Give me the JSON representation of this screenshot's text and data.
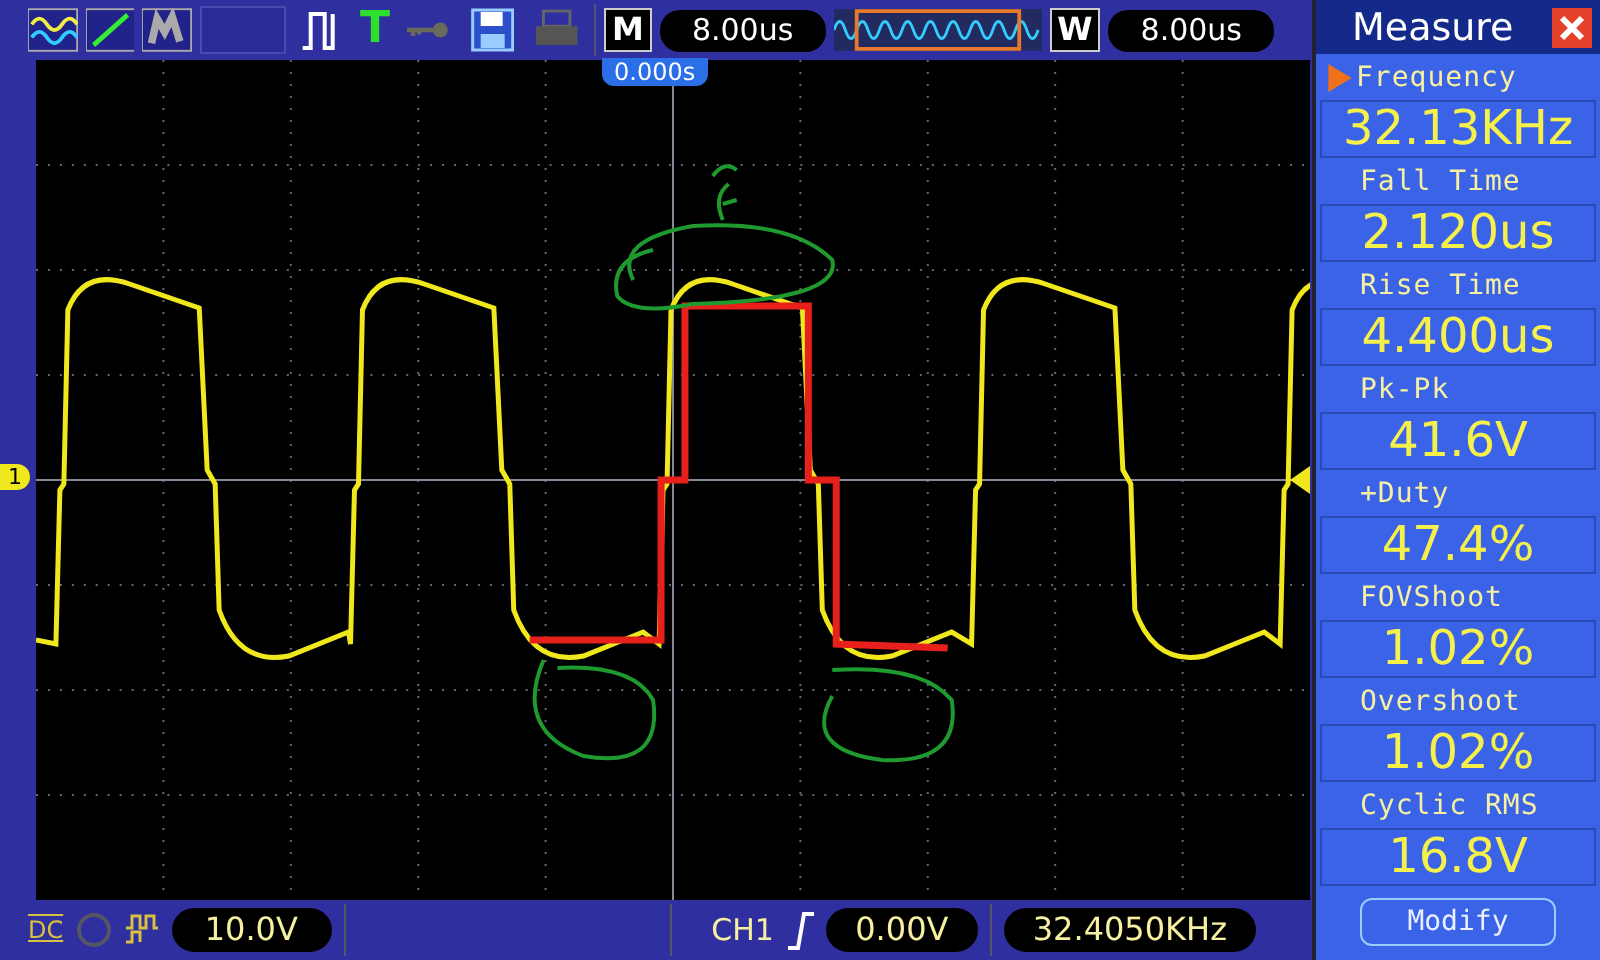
{
  "toolbar": {
    "trigger_label": "T",
    "timebase": {
      "label": "M",
      "value": "8.00us"
    },
    "window": {
      "label": "W",
      "value": "8.00us"
    }
  },
  "screen": {
    "trigger_time": "0.000s",
    "channel_marker": "1"
  },
  "status_bar": {
    "coupling": "DC",
    "volts_div": "10.0V",
    "trigger_source": "CH1",
    "trigger_level": "0.00V",
    "trigger_frequency": "32.4050KHz"
  },
  "measure": {
    "title": "Measure",
    "items": [
      {
        "label": "Frequency",
        "value": "32.13KHz",
        "selected": true
      },
      {
        "label": "Fall Time",
        "value": "2.120us",
        "selected": false
      },
      {
        "label": "Rise Time",
        "value": "4.400us",
        "selected": false
      },
      {
        "label": "Pk-Pk",
        "value": "41.6V",
        "selected": false
      },
      {
        "label": "+Duty",
        "value": "47.4%",
        "selected": false
      },
      {
        "label": "FOVShoot",
        "value": "1.02%",
        "selected": false
      },
      {
        "label": "Overshoot",
        "value": "1.02%",
        "selected": false
      },
      {
        "label": "Cyclic RMS",
        "value": "16.8V",
        "selected": false
      }
    ],
    "button": "Modify"
  }
}
